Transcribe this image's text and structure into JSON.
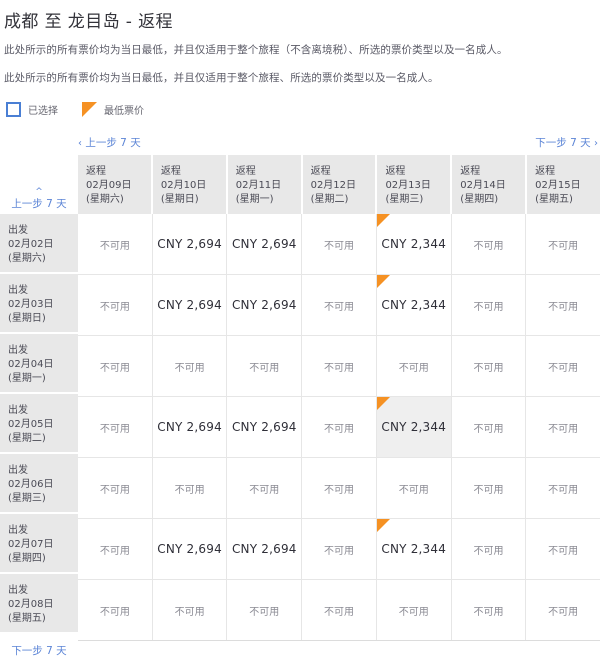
{
  "header": {
    "title": "成都 至 龙目岛 - 返程",
    "notes": [
      "此处所示的所有票价均为当日最低，并且仅适用于整个旅程（不含离境税）、所选的票价类型以及一名成人。",
      "此处所示的所有票价均为当日最低，并且仅适用于整个旅程、所选的票价类型以及一名成人。"
    ]
  },
  "legend": {
    "selected_label": "已选择",
    "lowest_fare_label": "最低票价",
    "selected_color": "#4a7fd4",
    "lowest_fare_color": "#f59123"
  },
  "nav": {
    "prev_7_days": "上一步 7 天",
    "next_7_days": "下一步 7 天",
    "prev_chevron": "chevron-left-icon",
    "next_chevron": "chevron-right-icon",
    "up_chevron": "chevron-up-icon",
    "rail_prev_label": "上一步 7 天",
    "rail_next_label": "下一步 7 天"
  },
  "matrix": {
    "return_prefix": "返程",
    "depart_prefix": "出发",
    "unavailable_label": "不可用",
    "columns": [
      {
        "prefix": "返程",
        "date": "02月09日 (星期六)"
      },
      {
        "prefix": "返程",
        "date": "02月10日 (星期日)"
      },
      {
        "prefix": "返程",
        "date": "02月11日 (星期一)"
      },
      {
        "prefix": "返程",
        "date": "02月12日 (星期二)"
      },
      {
        "prefix": "返程",
        "date": "02月13日 (星期三)"
      },
      {
        "prefix": "返程",
        "date": "02月14日 (星期四)"
      },
      {
        "prefix": "返程",
        "date": "02月15日 (星期五)"
      }
    ],
    "rows": [
      {
        "prefix": "出发",
        "date": "02月02日 (星期六)",
        "cells": [
          {
            "text": "不可用",
            "available": false,
            "lowest": false,
            "hovered": false
          },
          {
            "text": "CNY 2,694",
            "available": true,
            "lowest": false,
            "hovered": false
          },
          {
            "text": "CNY 2,694",
            "available": true,
            "lowest": false,
            "hovered": false
          },
          {
            "text": "不可用",
            "available": false,
            "lowest": false,
            "hovered": false
          },
          {
            "text": "CNY 2,344",
            "available": true,
            "lowest": true,
            "hovered": false
          },
          {
            "text": "不可用",
            "available": false,
            "lowest": false,
            "hovered": false
          },
          {
            "text": "不可用",
            "available": false,
            "lowest": false,
            "hovered": false
          }
        ]
      },
      {
        "prefix": "出发",
        "date": "02月03日 (星期日)",
        "cells": [
          {
            "text": "不可用",
            "available": false,
            "lowest": false,
            "hovered": false
          },
          {
            "text": "CNY 2,694",
            "available": true,
            "lowest": false,
            "hovered": false
          },
          {
            "text": "CNY 2,694",
            "available": true,
            "lowest": false,
            "hovered": false
          },
          {
            "text": "不可用",
            "available": false,
            "lowest": false,
            "hovered": false
          },
          {
            "text": "CNY 2,344",
            "available": true,
            "lowest": true,
            "hovered": false
          },
          {
            "text": "不可用",
            "available": false,
            "lowest": false,
            "hovered": false
          },
          {
            "text": "不可用",
            "available": false,
            "lowest": false,
            "hovered": false
          }
        ]
      },
      {
        "prefix": "出发",
        "date": "02月04日 (星期一)",
        "cells": [
          {
            "text": "不可用",
            "available": false,
            "lowest": false,
            "hovered": false
          },
          {
            "text": "不可用",
            "available": false,
            "lowest": false,
            "hovered": false
          },
          {
            "text": "不可用",
            "available": false,
            "lowest": false,
            "hovered": false
          },
          {
            "text": "不可用",
            "available": false,
            "lowest": false,
            "hovered": false
          },
          {
            "text": "不可用",
            "available": false,
            "lowest": false,
            "hovered": false
          },
          {
            "text": "不可用",
            "available": false,
            "lowest": false,
            "hovered": false
          },
          {
            "text": "不可用",
            "available": false,
            "lowest": false,
            "hovered": false
          }
        ]
      },
      {
        "prefix": "出发",
        "date": "02月05日 (星期二)",
        "cells": [
          {
            "text": "不可用",
            "available": false,
            "lowest": false,
            "hovered": false
          },
          {
            "text": "CNY 2,694",
            "available": true,
            "lowest": false,
            "hovered": false
          },
          {
            "text": "CNY 2,694",
            "available": true,
            "lowest": false,
            "hovered": false
          },
          {
            "text": "不可用",
            "available": false,
            "lowest": false,
            "hovered": false
          },
          {
            "text": "CNY 2,344",
            "available": true,
            "lowest": true,
            "hovered": true
          },
          {
            "text": "不可用",
            "available": false,
            "lowest": false,
            "hovered": false
          },
          {
            "text": "不可用",
            "available": false,
            "lowest": false,
            "hovered": false
          }
        ]
      },
      {
        "prefix": "出发",
        "date": "02月06日 (星期三)",
        "cells": [
          {
            "text": "不可用",
            "available": false,
            "lowest": false,
            "hovered": false
          },
          {
            "text": "不可用",
            "available": false,
            "lowest": false,
            "hovered": false
          },
          {
            "text": "不可用",
            "available": false,
            "lowest": false,
            "hovered": false
          },
          {
            "text": "不可用",
            "available": false,
            "lowest": false,
            "hovered": false
          },
          {
            "text": "不可用",
            "available": false,
            "lowest": false,
            "hovered": false
          },
          {
            "text": "不可用",
            "available": false,
            "lowest": false,
            "hovered": false
          },
          {
            "text": "不可用",
            "available": false,
            "lowest": false,
            "hovered": false
          }
        ]
      },
      {
        "prefix": "出发",
        "date": "02月07日 (星期四)",
        "cells": [
          {
            "text": "不可用",
            "available": false,
            "lowest": false,
            "hovered": false
          },
          {
            "text": "CNY 2,694",
            "available": true,
            "lowest": false,
            "hovered": false
          },
          {
            "text": "CNY 2,694",
            "available": true,
            "lowest": false,
            "hovered": false
          },
          {
            "text": "不可用",
            "available": false,
            "lowest": false,
            "hovered": false
          },
          {
            "text": "CNY 2,344",
            "available": true,
            "lowest": true,
            "hovered": false
          },
          {
            "text": "不可用",
            "available": false,
            "lowest": false,
            "hovered": false
          },
          {
            "text": "不可用",
            "available": false,
            "lowest": false,
            "hovered": false
          }
        ]
      },
      {
        "prefix": "出发",
        "date": "02月08日 (星期五)",
        "cells": [
          {
            "text": "不可用",
            "available": false,
            "lowest": false,
            "hovered": false
          },
          {
            "text": "不可用",
            "available": false,
            "lowest": false,
            "hovered": false
          },
          {
            "text": "不可用",
            "available": false,
            "lowest": false,
            "hovered": false
          },
          {
            "text": "不可用",
            "available": false,
            "lowest": false,
            "hovered": false
          },
          {
            "text": "不可用",
            "available": false,
            "lowest": false,
            "hovered": false
          },
          {
            "text": "不可用",
            "available": false,
            "lowest": false,
            "hovered": false
          },
          {
            "text": "不可用",
            "available": false,
            "lowest": false,
            "hovered": false
          }
        ]
      }
    ]
  }
}
